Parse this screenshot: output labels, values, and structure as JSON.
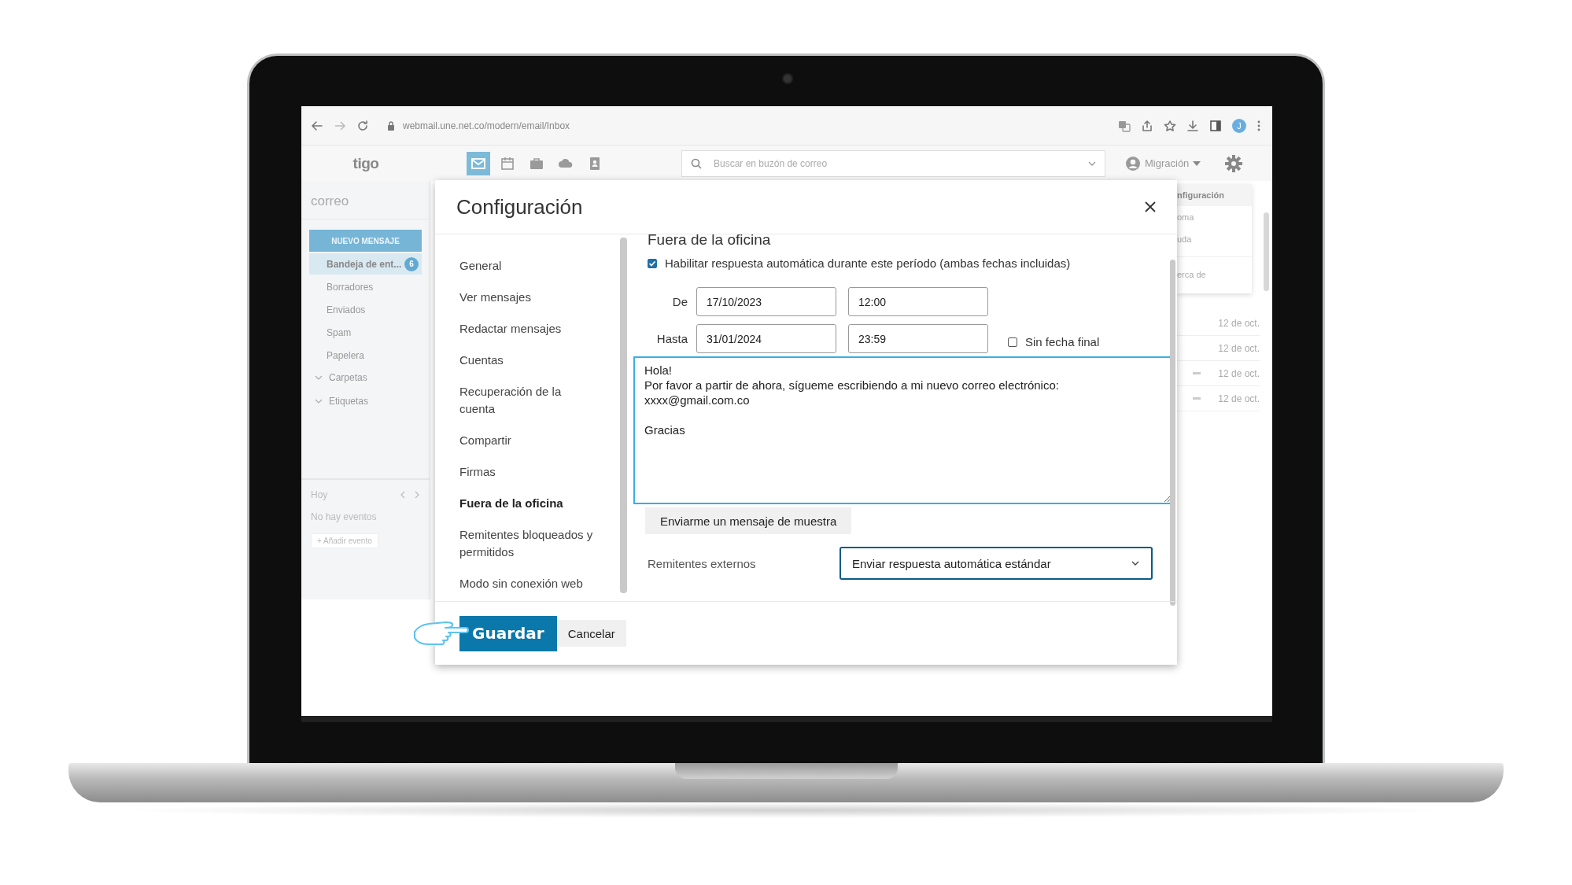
{
  "browser": {
    "url": "webmail.une.net.co/modern/email/Inbox",
    "profile_initial": "J"
  },
  "app_header": {
    "logo": "tigo",
    "apps": [
      {
        "kind": "mail",
        "selected": true
      },
      {
        "kind": "calendar",
        "selected": false
      },
      {
        "kind": "briefcase",
        "selected": false
      },
      {
        "kind": "cloud",
        "selected": false
      },
      {
        "kind": "contacts",
        "selected": false
      }
    ],
    "search": {
      "placeholder": "Buscar en buzón de correo"
    },
    "account": "Migración"
  },
  "sidebar": {
    "title": "correo",
    "new_button": "NUEVO MENSAJE",
    "folders": [
      {
        "label": "Bandeja de ent...",
        "selected": true,
        "badge": "6"
      },
      {
        "label": "Borradores",
        "selected": false
      },
      {
        "label": "Enviados",
        "selected": false
      },
      {
        "label": "Spam",
        "selected": false
      },
      {
        "label": "Papelera",
        "selected": false
      }
    ],
    "groups": [
      "Carpetas",
      "Etiquetas"
    ],
    "calendar": {
      "title": "Hoy",
      "empty": "No hay eventos",
      "add_button": "+ Añadir evento"
    }
  },
  "message_list": {
    "rows": [
      {
        "date": "12 de oct.",
        "marked": false
      },
      {
        "date": "12 de oct.",
        "marked": false
      },
      {
        "date": "12 de oct.",
        "marked": true
      },
      {
        "date": "12 de oct.",
        "marked": true
      }
    ]
  },
  "settings_menu": {
    "items": [
      {
        "kind": "header",
        "label": "nfiguración"
      },
      {
        "kind": "item",
        "label": "oma"
      },
      {
        "kind": "item",
        "label": "uda"
      },
      {
        "kind": "divider"
      },
      {
        "kind": "item",
        "label": "erca de"
      }
    ]
  },
  "dialog": {
    "title": "Configuración",
    "nav": [
      {
        "label": "General",
        "selected": false
      },
      {
        "label": "Ver mensajes",
        "selected": false
      },
      {
        "label": "Redactar mensajes",
        "selected": false
      },
      {
        "label": "Cuentas",
        "selected": false
      },
      {
        "label": "Recuperación de la cuenta",
        "selected": false
      },
      {
        "label": "Compartir",
        "selected": false
      },
      {
        "label": "Firmas",
        "selected": false
      },
      {
        "label": "Fuera de la oficina",
        "selected": true
      },
      {
        "label": "Remitentes bloqueados y permitidos",
        "selected": false
      },
      {
        "label": "Modo sin conexión web",
        "selected": false
      }
    ],
    "section_title": "Fuera de la oficina",
    "enable": {
      "label": "Habilitar respuesta automática durante este período (ambas fechas incluidas)",
      "checked": true
    },
    "from": {
      "label": "De",
      "date": "17/10/2023",
      "time": "12:00"
    },
    "to": {
      "label": "Hasta",
      "date": "31/01/2024",
      "time": "23:59"
    },
    "no_end": {
      "label": "Sin fecha final",
      "checked": false
    },
    "message": "Hola!\nPor favor a partir de ahora, sígueme escribiendo a mi nuevo correo electrónico:\nxxxx@gmail.com.co\n\nGracias",
    "sample_button": "Enviarme un mensaje de muestra",
    "external": {
      "label": "Remitentes externos",
      "value": "Enviar respuesta automática estándar"
    },
    "save_button": "Guardar",
    "cancel_button": "Cancelar"
  }
}
